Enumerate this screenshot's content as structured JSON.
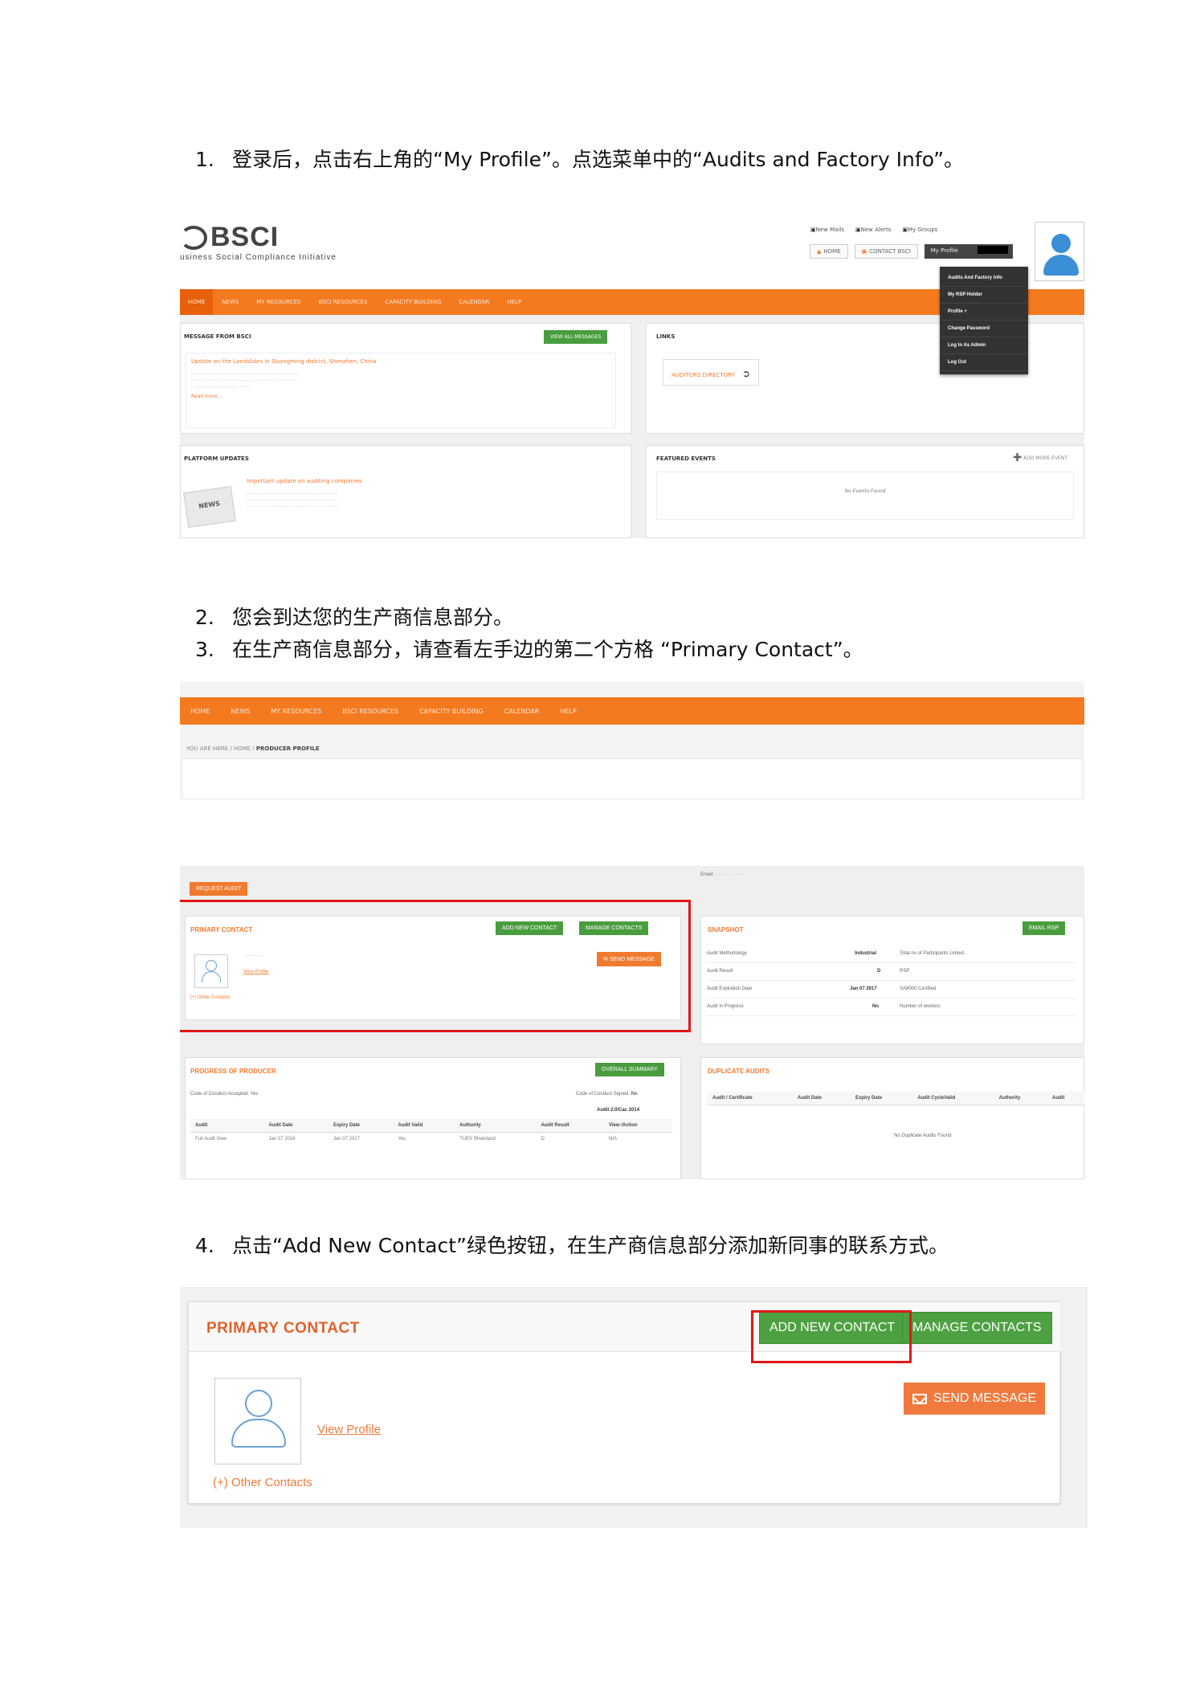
{
  "steps": {
    "s1": {
      "num": "1.",
      "text": "登录后，点击右上角的“My Profile”。点选菜单中的“Audits and Factory Info”。"
    },
    "s2": {
      "num": "2.",
      "text": "您会到达您的生产商信息部分。"
    },
    "s3": {
      "num": "3.",
      "text": "在生产商信息部分，请查看左手边的第二个方格 “Primary Contact”。"
    },
    "s4": {
      "num": "4.",
      "text": "点击“Add New Contact”绿色按钮，在生产商信息部分添加新同事的联系方式。"
    }
  },
  "shot1": {
    "logo": "BSCI",
    "logo_sub": "usiness Social Compliance Initiative",
    "toplinks": [
      "New Mails",
      "New Alerts",
      "My Groups"
    ],
    "home": "HOME",
    "contact": "CONTACT BSCI",
    "profile": "My Profile",
    "nav": [
      "HOME",
      "NEWS",
      "MY RESOURCES",
      "BSCI RESOURCES",
      "CAPACITY BUILDING",
      "CALENDAR",
      "HELP"
    ],
    "menu": [
      "Audits And Factory Info",
      "My RSP Holder",
      "Profile +",
      "Change Password",
      "Log In As Admin",
      "Log Out"
    ],
    "message_title": "MESSAGE FROM BSCI",
    "view_all": "VIEW ALL MESSAGES",
    "message_headline": "Update on the Landslides in Guangming district, Shenzhen, China",
    "read_more": "Read more...",
    "links_title": "LINKS",
    "auditors_link": "AUDITORS DIRECTORY",
    "updates_title": "PLATFORM UPDATES",
    "news_label": "NEWS",
    "update_headline": "Important update on auditing companies",
    "events_title": "FEATURED EVENTS",
    "add_event": "ADD MORE EVENT",
    "no_events": "No Events Found"
  },
  "shot2": {
    "nav": [
      "HOME",
      "NEWS",
      "MY RESOURCES",
      "BSCI RESOURCES",
      "CAPACITY BUILDING",
      "CALENDAR",
      "HELP"
    ],
    "crumb_prefix": "YOU ARE HERE / HOME /",
    "crumb_current": "PRODUCER PROFILE",
    "request_audit": "REQUEST AUDIT",
    "primary_contact": "PRIMARY CONTACT",
    "add_new_contact": "ADD NEW CONTACT",
    "manage_contacts": "MANAGE CONTACTS",
    "send_message": "SEND MESSAGE",
    "view_profile": "View Profile",
    "other_contacts": "(+) Other Contacts",
    "snapshot": "SNAPSHOT",
    "email_rsp": "EMAIL RSP",
    "snapshot_rows": [
      {
        "label": "Audit Methodology",
        "value": "Industrial",
        "right": "Total no of Participants Linked"
      },
      {
        "label": "Audit Result",
        "value": "D",
        "right": "RSP"
      },
      {
        "label": "Audit Expiration Date",
        "value": "Jan 07 2017",
        "right": "SA8000 Certified"
      },
      {
        "label": "Audit in Progress",
        "value": "No",
        "right": "Number of workers"
      }
    ],
    "progress_title": "PROGRESS OF PRODUCER",
    "overall_summary": "OVERALL SUMMARY",
    "coc_accepted": "Code of Conduct Accepted: Yes",
    "coc_signed_label": "Code of Conduct Signed:",
    "coc_signed_value": "No",
    "audit_version": "Audit 2.0/Cac 2014",
    "progress_headers": [
      "Audit",
      "Audit Date",
      "Expiry Date",
      "Audit Valid",
      "Authority",
      "Audit Result",
      "View /Action"
    ],
    "progress_row": [
      "Full Audit View",
      "Jan 07 2016",
      "Jan 07 2017",
      "Yes",
      "TUEV Rheinland",
      "D",
      "N/A"
    ],
    "duplicate_title": "DUPLICATE AUDITS",
    "duplicate_headers": [
      "Audit / Certificate",
      "Audit Date",
      "Expiry Date",
      "Audit CycleValid",
      "Authority",
      "Audit"
    ],
    "no_duplicates": "No Duplicate Audits Found"
  },
  "shot3": {
    "title": "PRIMARY CONTACT",
    "add_new_contact": "ADD NEW CONTACT",
    "manage_contacts": "MANAGE CONTACTS",
    "send_message": "SEND MESSAGE",
    "view_profile": "View Profile",
    "other_contacts": "(+) Other Contacts"
  }
}
